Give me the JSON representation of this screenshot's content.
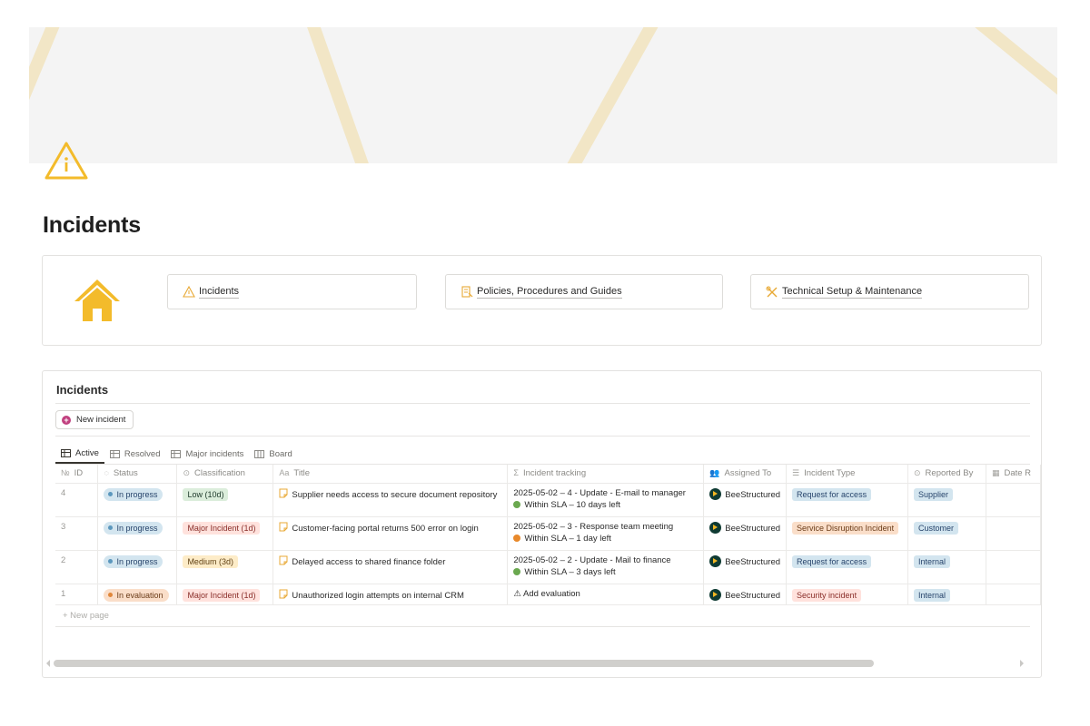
{
  "page": {
    "title": "Incidents"
  },
  "nav_links": [
    {
      "label": "Incidents",
      "icon": "warning-icon"
    },
    {
      "label": "Policies, Procedures and Guides",
      "icon": "document-icon"
    },
    {
      "label": "Technical Setup & Maintenance",
      "icon": "tools-icon"
    }
  ],
  "database": {
    "title": "Incidents",
    "new_button": "New incident",
    "tabs": [
      "Active",
      "Resolved",
      "Major incidents",
      "Board"
    ],
    "active_tab": "Active",
    "columns": [
      "ID",
      "Status",
      "Classification",
      "Title",
      "Incident tracking",
      "Assigned To",
      "Incident Type",
      "Reported By",
      "Date R"
    ],
    "rows": [
      {
        "id": "4",
        "status": "In progress",
        "classification": "Low (10d)",
        "title": "Supplier needs access to secure document repository",
        "tracking": "2025-05-02 – 4 - Update - E-mail to manager",
        "sla": "Within SLA – 10 days left",
        "assigned": "BeeStructured",
        "type": "Request for access",
        "reported": "Supplier"
      },
      {
        "id": "3",
        "status": "In progress",
        "classification": "Major Incident (1d)",
        "title": "Customer-facing portal returns 500 error on login",
        "tracking": "2025-05-02 – 3 - Response team meeting",
        "sla": "Within SLA – 1 day left",
        "assigned": "BeeStructured",
        "type": "Service Disruption Incident",
        "reported": "Customer"
      },
      {
        "id": "2",
        "status": "In progress",
        "classification": "Medium (3d)",
        "title": "Delayed access to shared finance folder",
        "tracking": "2025-05-02 – 2 - Update - Mail to finance",
        "sla": "Within SLA – 3 days left",
        "assigned": "BeeStructured",
        "type": "Request for access",
        "reported": "Internal"
      },
      {
        "id": "1",
        "status": "In evaluation",
        "classification": "Major Incident (1d)",
        "title": "Unauthorized login attempts on internal CRM",
        "tracking": "⚠ Add evaluation",
        "sla": "",
        "assigned": "BeeStructured",
        "type": "Security incident",
        "reported": "Internal"
      }
    ],
    "new_page": "+ New page"
  },
  "colors": {
    "accent_yellow": "#f3bb2b",
    "in_progress_bg": "#d3e5ef",
    "in_evaluation_bg": "#fadec9",
    "low_bg": "#dbeddb",
    "major_bg": "#ffe2dd",
    "medium_bg": "#fdecc8",
    "sla_green": "#6aa84f",
    "sla_orange": "#e8892b"
  }
}
